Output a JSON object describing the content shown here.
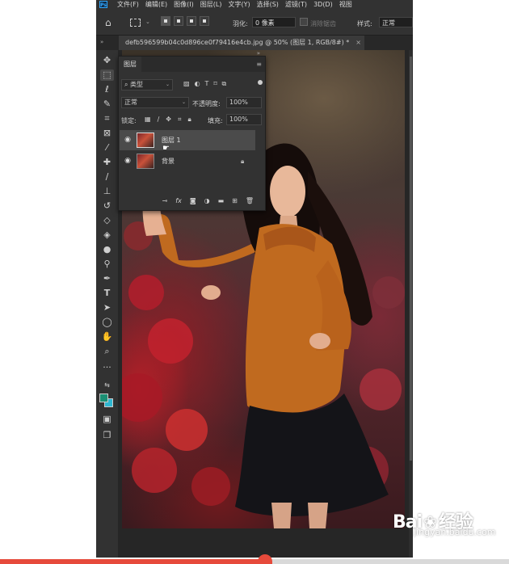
{
  "menubar": {
    "logo": "Ps",
    "items": [
      "文件(F)",
      "编辑(E)",
      "图像(I)",
      "图层(L)",
      "文字(Y)",
      "选择(S)",
      "滤镜(T)",
      "3D(D)",
      "视图"
    ]
  },
  "options": {
    "feather_label": "羽化:",
    "feather_value": "0 像素",
    "antialias_label": "消除锯齿",
    "style_label": "样式:",
    "style_value": "正常"
  },
  "document_tab": {
    "title": "defb596599b04c0d896ce0f79416e4cb.jpg @ 50% (图层 1, RGB/8#) *",
    "close": "×"
  },
  "tools": [
    "move-icon",
    "marquee-icon",
    "lasso-icon",
    "quick-select-icon",
    "crop-icon",
    "frame-icon",
    "eyedropper-icon",
    "healing-icon",
    "brush-icon",
    "stamp-icon",
    "history-brush-icon",
    "eraser-icon",
    "bucket-icon",
    "blur-icon",
    "dodge-icon",
    "pen-icon",
    "type-icon",
    "path-select-icon",
    "ellipse-icon",
    "hand-icon",
    "zoom-icon",
    "more-icon"
  ],
  "colors": {
    "foreground": "#1b8f74",
    "background": "#2eb7d2",
    "accent": "#e64a3b"
  },
  "layers_panel": {
    "tab": "图层",
    "filter_kind": "类型",
    "blend_mode": "正常",
    "opacity_label": "不透明度:",
    "opacity_value": "100%",
    "lock_label": "锁定:",
    "fill_label": "填充:",
    "fill_value": "100%",
    "layers": [
      {
        "name": "图层 1",
        "selected": true,
        "locked": false
      },
      {
        "name": "背景",
        "selected": false,
        "locked": true
      }
    ]
  },
  "watermark": {
    "brand": "Bai",
    "brand2": "经验",
    "site": "jingyan.baidu.com"
  },
  "playback": {
    "progress": 0.52
  }
}
